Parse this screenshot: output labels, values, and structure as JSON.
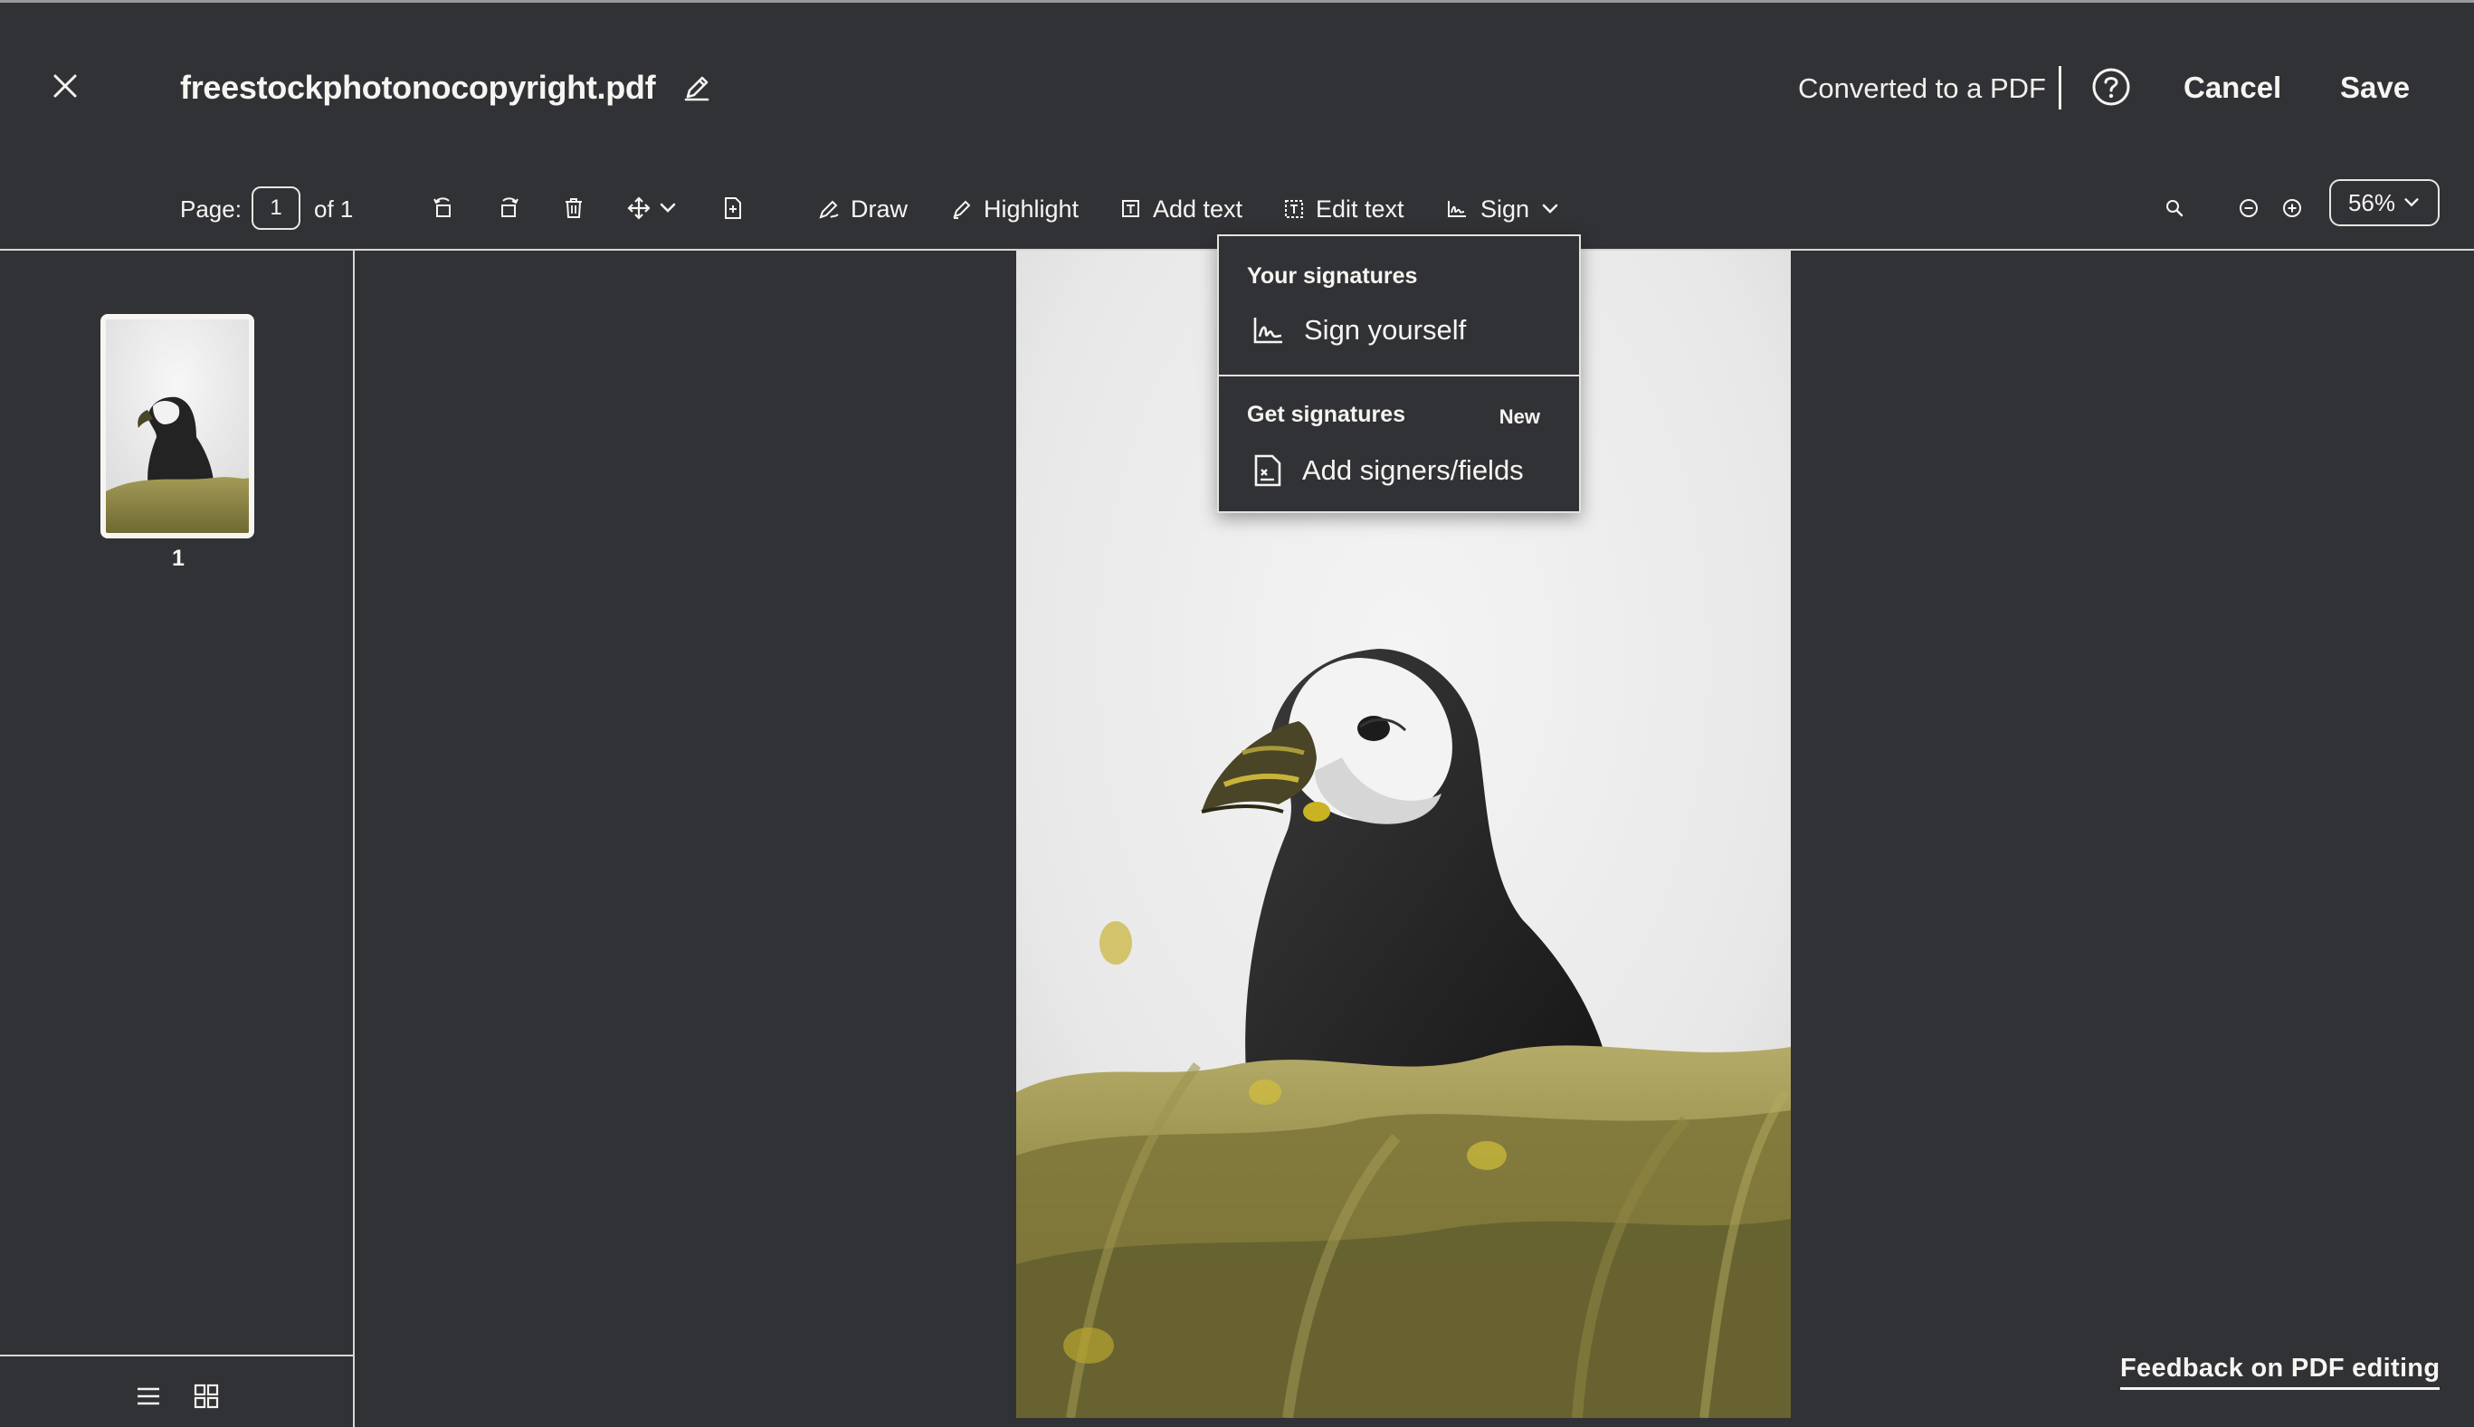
{
  "header": {
    "file_name": "freestockphotonocopyright.pdf",
    "status": "Converted to a PDF",
    "cancel_label": "Cancel",
    "save_label": "Save"
  },
  "toolbar": {
    "page_label": "Page:",
    "page_value": "1",
    "page_of": "of 1",
    "draw_label": "Draw",
    "highlight_label": "Highlight",
    "add_text_label": "Add text",
    "edit_text_label": "Edit text",
    "sign_label": "Sign",
    "zoom_value": "56%"
  },
  "sidebar": {
    "thumbnails": [
      {
        "page_number": "1"
      }
    ]
  },
  "sign_menu": {
    "your_signatures_title": "Your signatures",
    "sign_yourself_label": "Sign yourself",
    "get_signatures_title": "Get signatures",
    "new_badge": "New",
    "add_signers_label": "Add signers/fields"
  },
  "footer": {
    "feedback_label": "Feedback on PDF editing"
  },
  "icons": {
    "close": "close-icon",
    "rename": "pencil-icon",
    "help": "help-icon",
    "rotate_left": "rotate-left-icon",
    "rotate_right": "rotate-right-icon",
    "delete": "trash-icon",
    "move": "move-icon",
    "insert_page": "insert-page-icon",
    "draw": "draw-icon",
    "highlight": "highlighter-icon",
    "add_text": "add-text-icon",
    "edit_text": "edit-text-icon",
    "sign": "signature-icon",
    "search": "search-icon",
    "zoom_out": "zoom-out-icon",
    "zoom_in": "zoom-in-icon",
    "list_view": "list-view-icon",
    "grid_view": "grid-view-icon"
  },
  "colors": {
    "background": "#313235",
    "foreground": "#f7f5f2",
    "divider": "#d9d7d3"
  }
}
